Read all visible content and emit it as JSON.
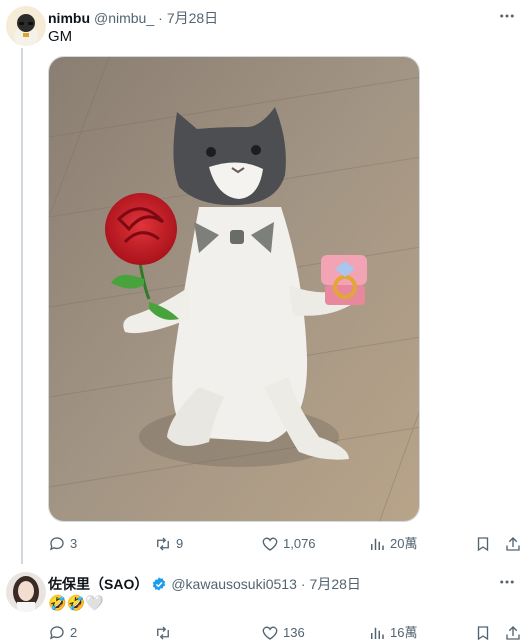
{
  "posts": [
    {
      "author_name": "nimbu",
      "author_handle": "@nimbu_",
      "separator": "·",
      "date": "7月28日",
      "text": "GM",
      "media": {
        "subject": "cat-with-rose-and-ring"
      },
      "stats": {
        "replies": "3",
        "reposts": "9",
        "likes": "1,076",
        "views": "20萬"
      }
    },
    {
      "author_name": "佐保里（SAO）",
      "verified": true,
      "author_handle": "@kawausosuki0513",
      "separator": "·",
      "date": "7月28日",
      "text": "🤣🤣🤍",
      "stats": {
        "replies": "2",
        "reposts": "",
        "likes": "136",
        "views": "16萬"
      }
    }
  ],
  "colors": {
    "text": "#0f1419",
    "muted": "#536471",
    "border": "#cfd9de",
    "verified": "#1d9bf0"
  },
  "icons": [
    "more-icon",
    "reply-icon",
    "repost-icon",
    "like-icon",
    "views-icon",
    "bookmark-icon",
    "share-icon",
    "verified-icon"
  ]
}
